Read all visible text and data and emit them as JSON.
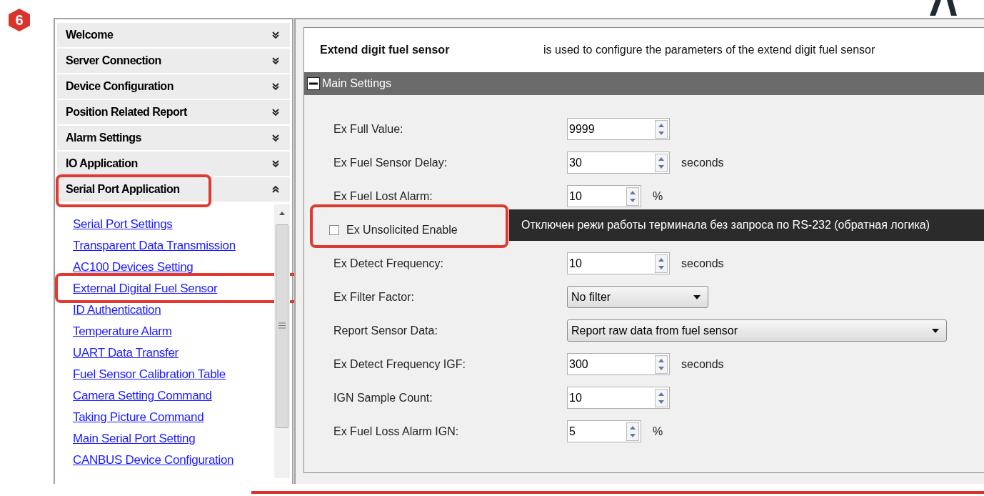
{
  "step_badge": "6",
  "sidebar": {
    "sections": [
      {
        "label": "Welcome",
        "expanded": false,
        "annotated": false
      },
      {
        "label": "Server Connection",
        "expanded": false,
        "annotated": false
      },
      {
        "label": "Device Configuration",
        "expanded": false,
        "annotated": false
      },
      {
        "label": "Position Related Report",
        "expanded": false,
        "annotated": false
      },
      {
        "label": "Alarm Settings",
        "expanded": false,
        "annotated": false
      },
      {
        "label": "IO Application",
        "expanded": false,
        "annotated": false
      },
      {
        "label": "Serial Port Application",
        "expanded": true,
        "annotated": true
      }
    ],
    "links": [
      {
        "label": "Serial Port Settings",
        "annotated": false
      },
      {
        "label": "Transparent Data Transmission",
        "annotated": false
      },
      {
        "label": "AC100 Devices Setting",
        "annotated": false
      },
      {
        "label": "External Digital Fuel Sensor",
        "annotated": true
      },
      {
        "label": "ID Authentication",
        "annotated": false
      },
      {
        "label": "Temperature Alarm",
        "annotated": false
      },
      {
        "label": "UART Data Transfer",
        "annotated": false
      },
      {
        "label": "Fuel Sensor Calibration Table",
        "annotated": false
      },
      {
        "label": "Camera Setting Command",
        "annotated": false
      },
      {
        "label": "Taking Picture Command",
        "annotated": false
      },
      {
        "label": "Main Serial Port Setting",
        "annotated": false
      },
      {
        "label": "CANBUS Device Configuration",
        "annotated": false
      }
    ]
  },
  "header": {
    "title": "Extend digit fuel sensor",
    "description": "is used to configure the parameters of the extend digit fuel sensor"
  },
  "section": {
    "title": "Main Settings",
    "expanded": true
  },
  "fields": [
    {
      "kind": "spinner",
      "label": "Ex Full Value:",
      "value": "9999"
    },
    {
      "kind": "spinner",
      "label": "Ex Fuel Sensor Delay:",
      "value": "30",
      "unit": "seconds"
    },
    {
      "kind": "short_spinner",
      "label": "Ex Fuel Lost Alarm:",
      "value": "10",
      "unit": "%"
    },
    {
      "kind": "checkbox",
      "label": "Ex Unsolicited Enable",
      "checked": false,
      "annotated": true,
      "tooltip": "Отключен режи работы терминала без запроса по RS-232 (обратная логика)"
    },
    {
      "kind": "spinner",
      "label": "Ex Detect Frequency:",
      "value": "10",
      "unit": "seconds"
    },
    {
      "kind": "select",
      "label": "Ex Filter Factor:",
      "value": "No filter"
    },
    {
      "kind": "wide_select",
      "label": "Report Sensor Data:",
      "value": "Report raw data from fuel sensor"
    },
    {
      "kind": "spinner",
      "label": "Ex Detect Frequency IGF:",
      "value": "300",
      "unit": "seconds"
    },
    {
      "kind": "spinner",
      "label": "IGN Sample Count:",
      "value": "10"
    },
    {
      "kind": "short_spinner",
      "label": "Ex Fuel Loss Alarm IGN:",
      "value": "5",
      "unit": "%"
    }
  ]
}
